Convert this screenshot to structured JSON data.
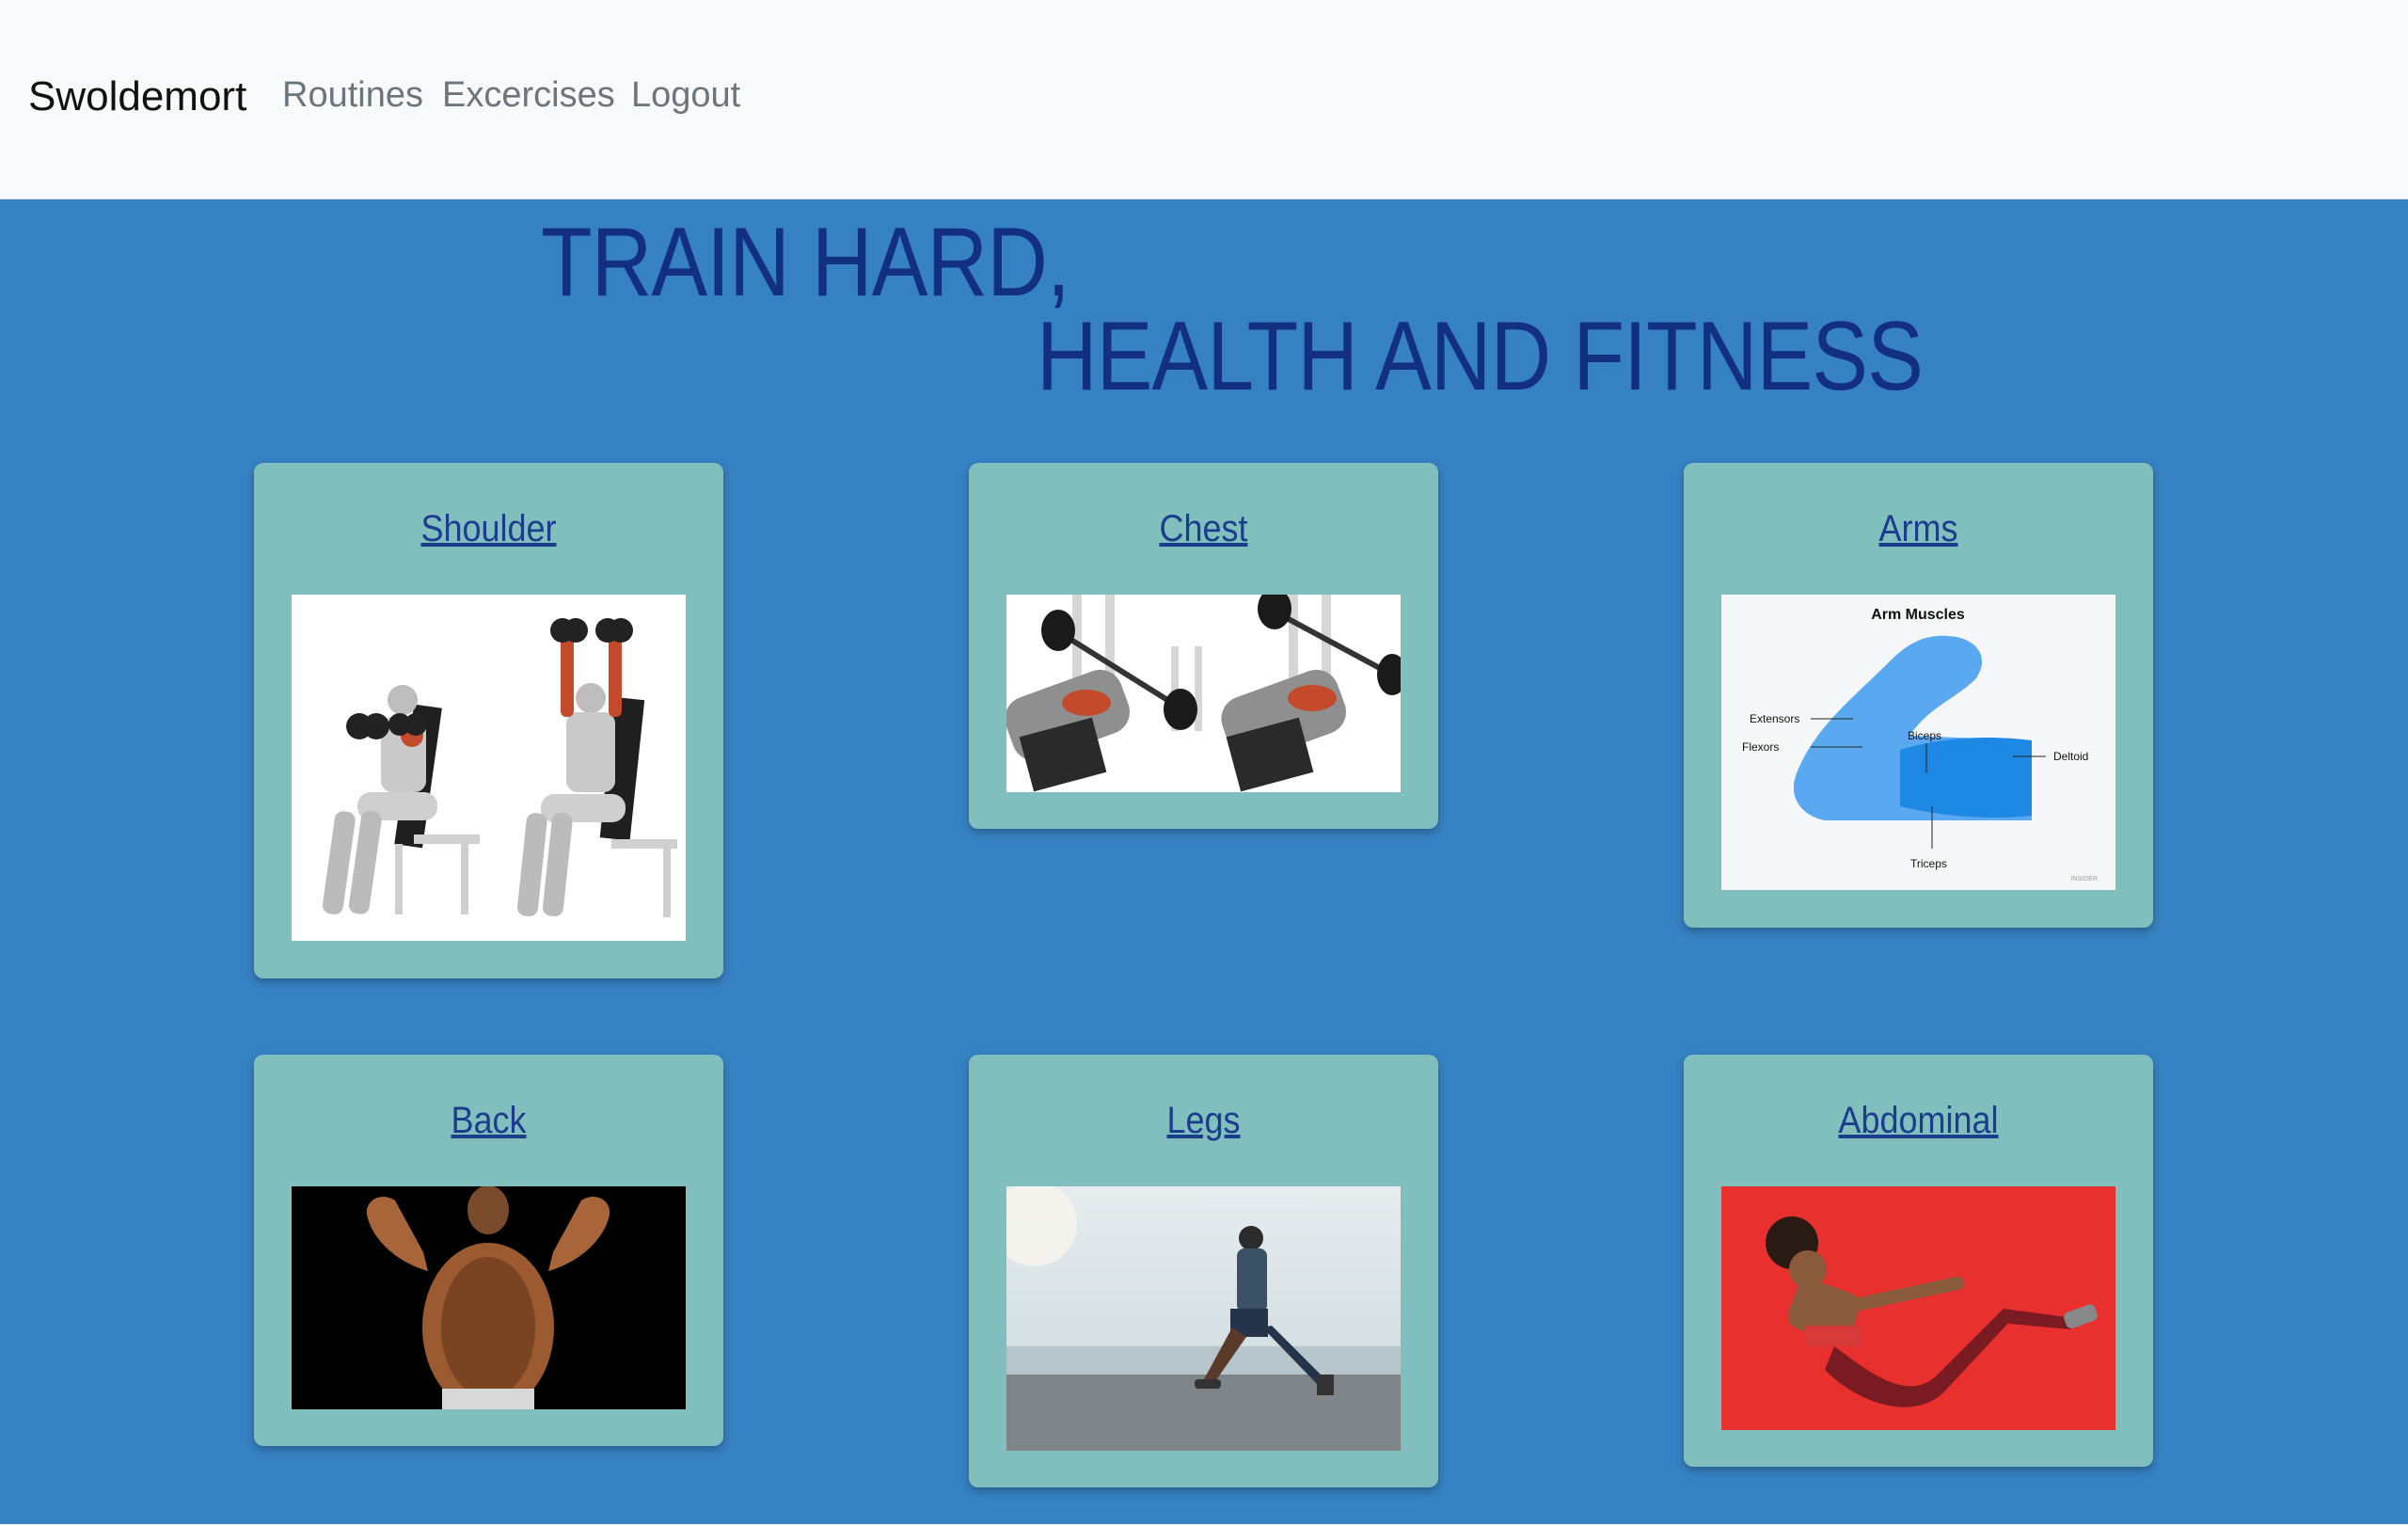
{
  "navbar": {
    "brand": "Swoldemort",
    "links": [
      "Routines",
      "Excercises",
      "Logout"
    ]
  },
  "hero": {
    "line1": "TRAIN HARD,",
    "line2": "HEALTH AND FITNESS"
  },
  "cards": [
    {
      "title": "Shoulder",
      "image": "seated-dumbbell-press-illustration"
    },
    {
      "title": "Chest",
      "image": "incline-bench-press-illustration"
    },
    {
      "title": "Arms",
      "image": "arm-muscles-diagram",
      "diagram": {
        "title": "Arm Muscles",
        "labels": [
          "Extensors",
          "Flexors",
          "Biceps",
          "Deltoid",
          "Triceps"
        ],
        "credit": "INSIDER"
      }
    },
    {
      "title": "Back",
      "image": "bodybuilder-back-double-biceps-photo"
    },
    {
      "title": "Legs",
      "image": "runner-lunge-photo"
    },
    {
      "title": "Abdominal",
      "image": "woman-v-sit-photo"
    }
  ],
  "colors": {
    "navbar_bg": "#f8f9fa",
    "page_bg": "#3681c2",
    "hero_text": "#13307f",
    "card_bg": "#81bfbf",
    "link": "#1b3d8c"
  }
}
